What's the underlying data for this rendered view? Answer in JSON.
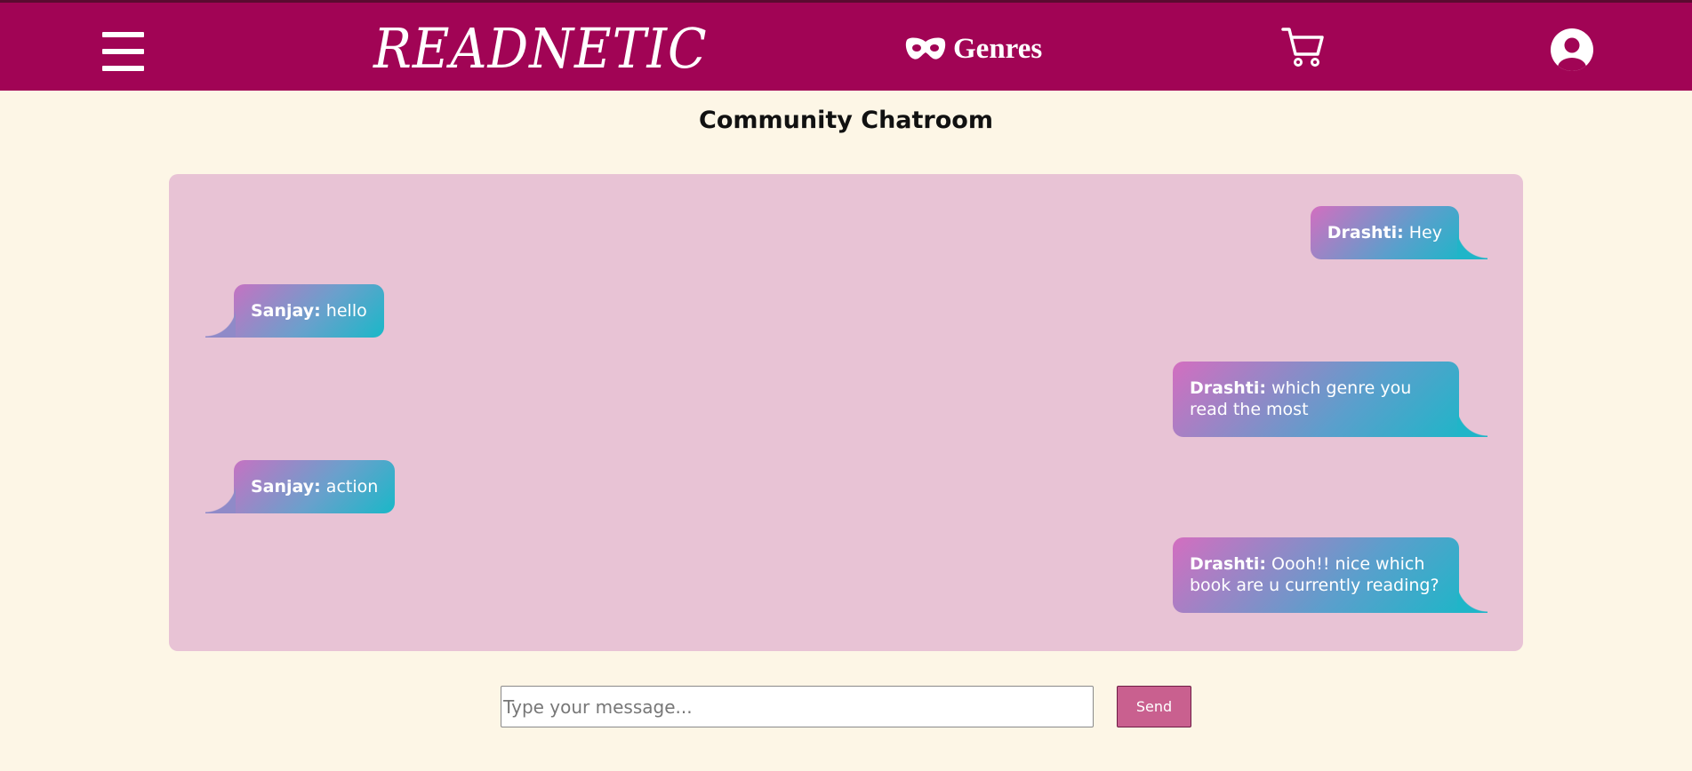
{
  "header": {
    "brand": "READNETIC",
    "genres_label": "Genres",
    "menu_icon": "hamburger-menu-icon",
    "genres_icon": "mask-icon",
    "cart_icon": "cart-icon",
    "user_icon": "user-circle-icon"
  },
  "page": {
    "title": "Community Chatroom"
  },
  "messages": [
    {
      "sender": "Drashti:",
      "text": " Hey",
      "side": "right"
    },
    {
      "sender": "Sanjay:",
      "text": " hello",
      "side": "left"
    },
    {
      "sender": "Drashti:",
      "text": " which genre you read the most",
      "side": "right"
    },
    {
      "sender": "Sanjay:",
      "text": " action",
      "side": "left"
    },
    {
      "sender": "Drashti:",
      "text": " Oooh!! nice which book are u currently reading?",
      "side": "right"
    }
  ],
  "composer": {
    "placeholder": "Type your message...",
    "value": "",
    "send_label": "Send"
  },
  "colors": {
    "header_bg": "#a10455",
    "page_bg": "#fdf6e6",
    "chat_bg": "#e8c3d5",
    "send_bg": "#c9608f"
  }
}
